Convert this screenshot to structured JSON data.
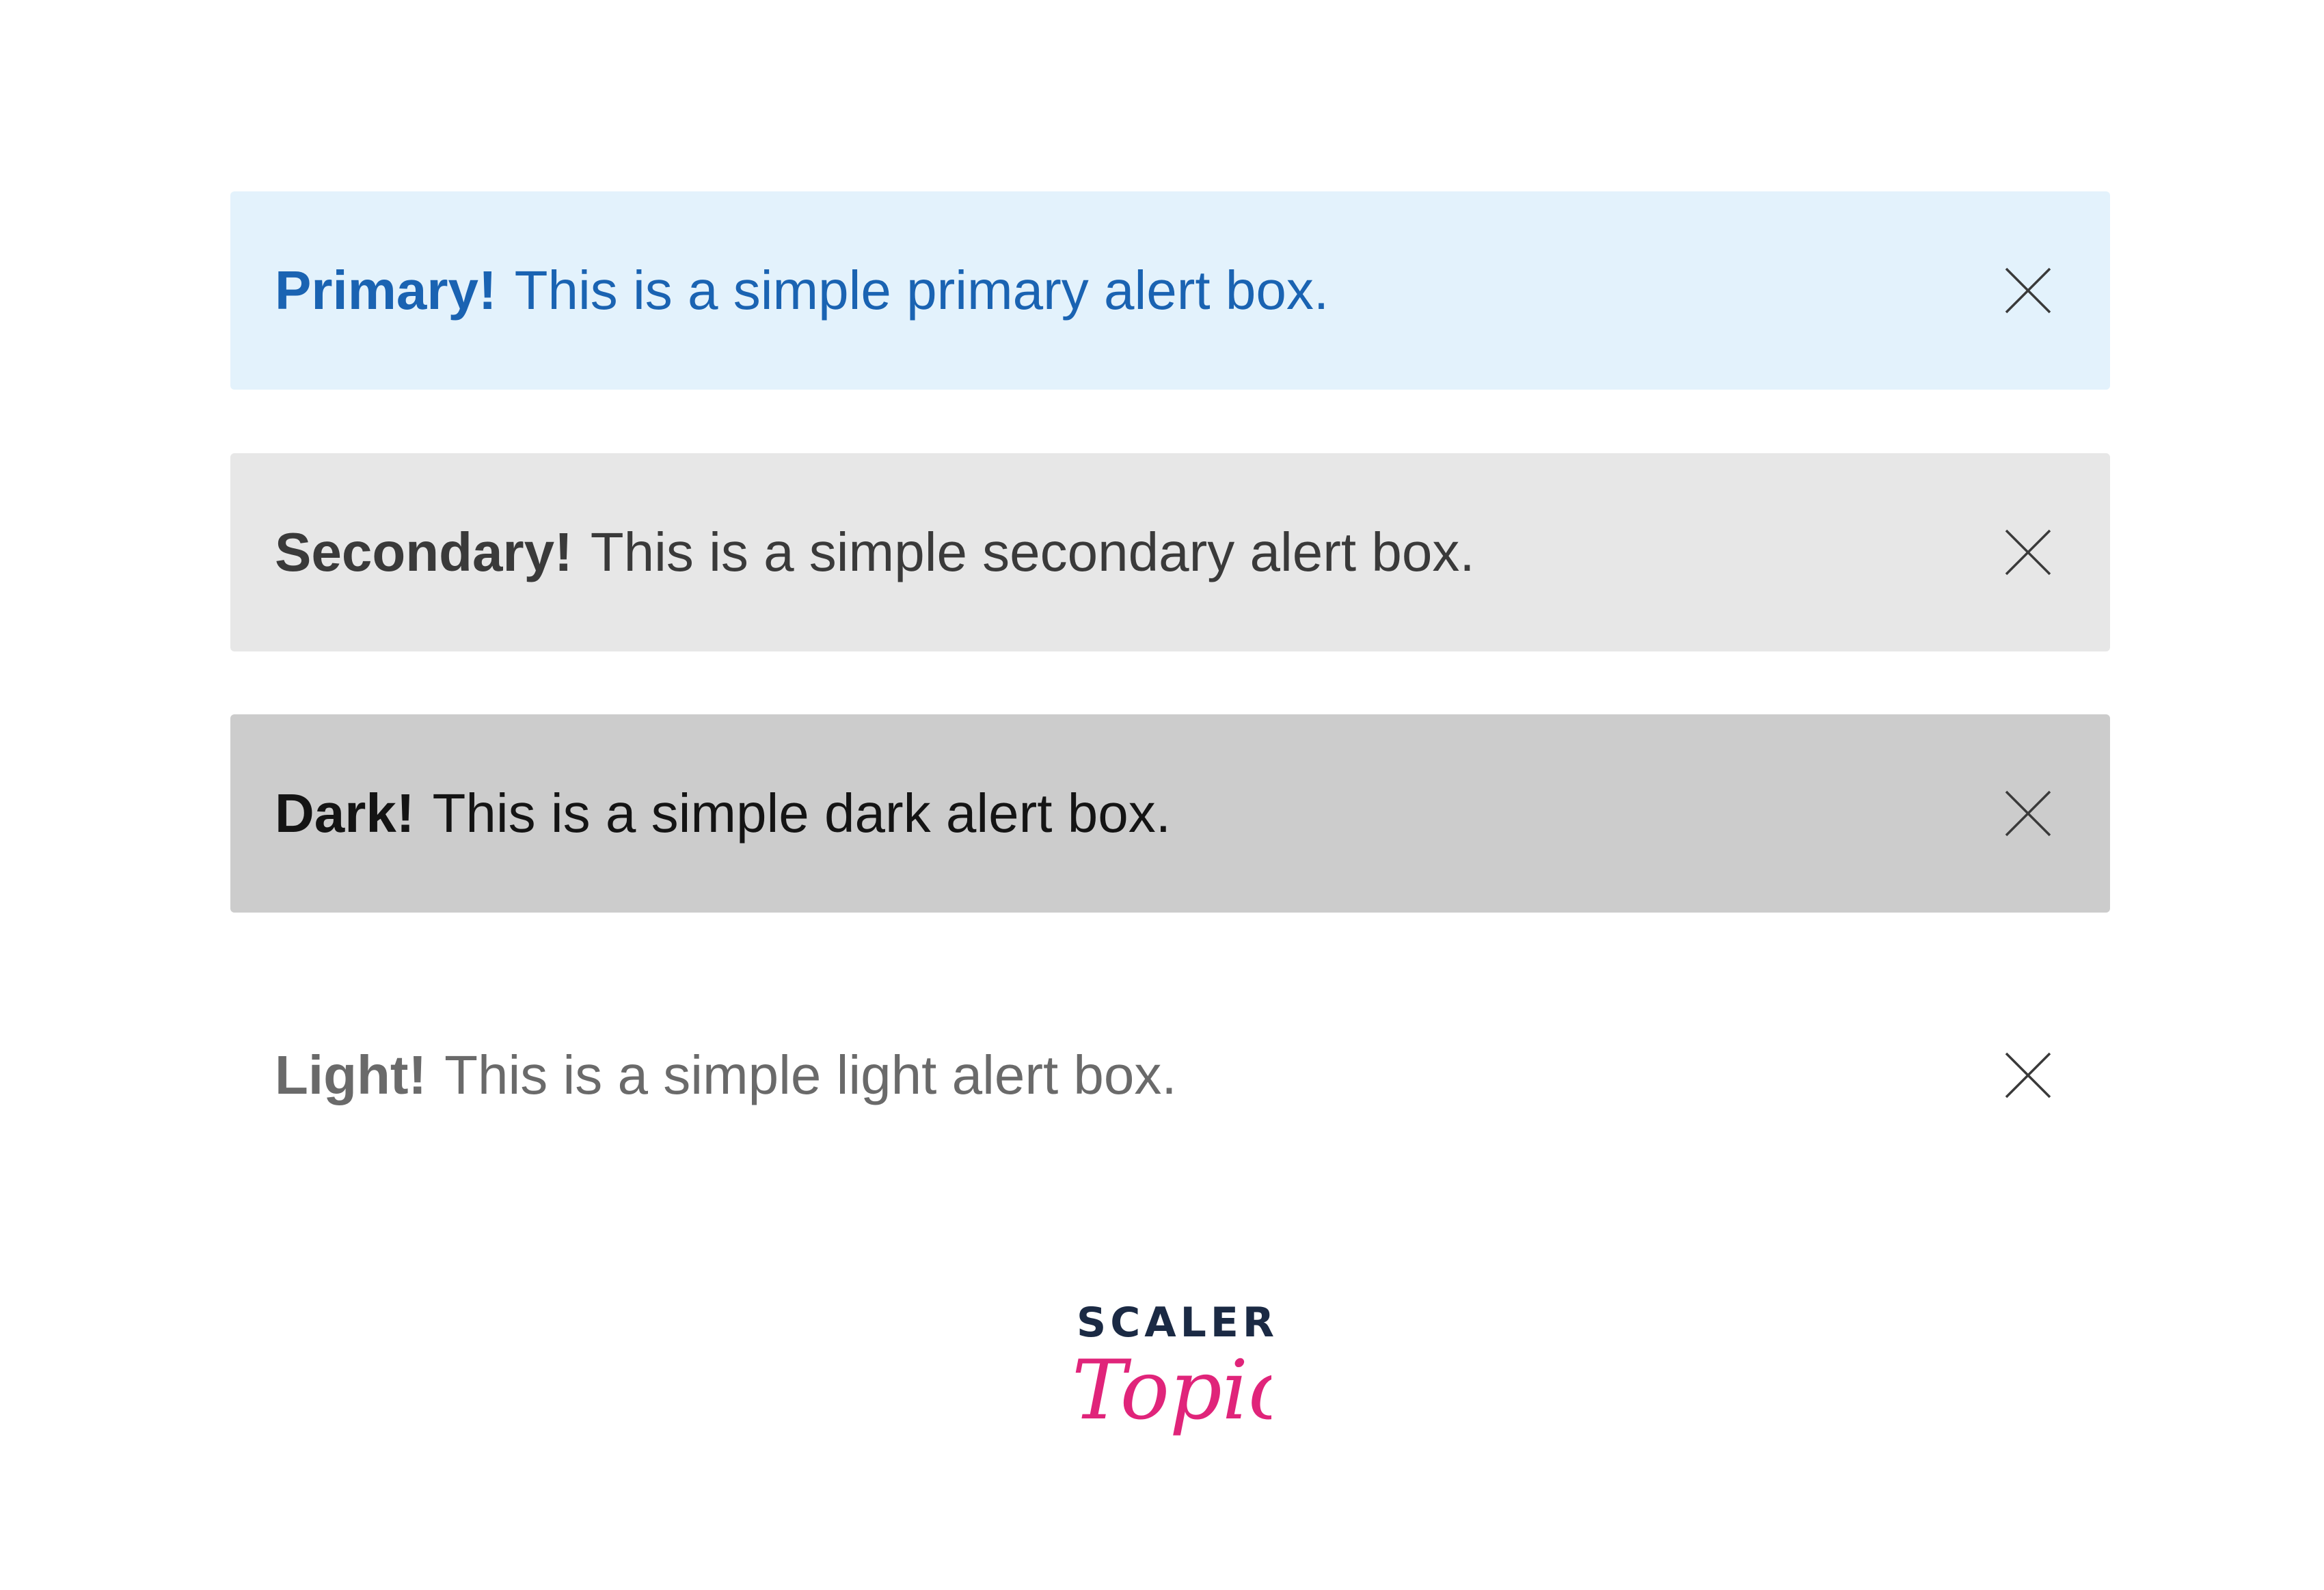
{
  "alerts": [
    {
      "variant": "primary",
      "title": "Primary!",
      "message": "This is a simple primary alert box.",
      "background": "#e3f2fc",
      "text_color": "#1a63b2",
      "close_icon": "close-icon"
    },
    {
      "variant": "secondary",
      "title": "Secondary!",
      "message": "This is a simple secondary alert box.",
      "background": "#e7e7e7",
      "text_color": "#3a3a3a",
      "close_icon": "close-icon"
    },
    {
      "variant": "dark",
      "title": "Dark!",
      "message": "This is a simple dark alert box.",
      "background": "#cccccc",
      "text_color": "#141414",
      "close_icon": "close-icon"
    },
    {
      "variant": "light",
      "title": "Light!",
      "message": "This is a simple light alert box.",
      "background": "#ffffff",
      "text_color": "#6a6a6a",
      "close_icon": "close-icon"
    }
  ],
  "logo": {
    "brand_top": "SCALER",
    "brand_script": "Topics",
    "brand_top_color": "#1b2a44",
    "brand_script_color": "#e0247a"
  }
}
